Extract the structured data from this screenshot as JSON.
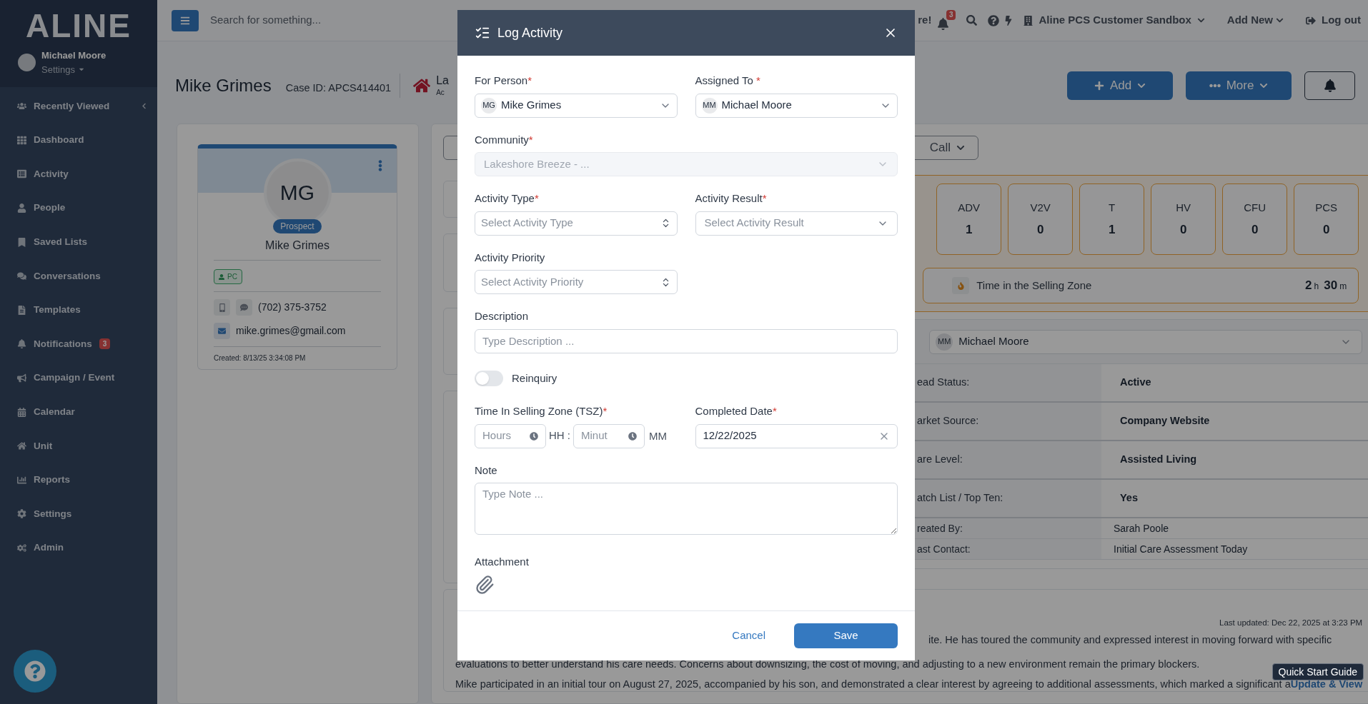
{
  "sidebar": {
    "logo": "ALINE",
    "user": {
      "name": "Michael Moore",
      "menu": "Settings"
    },
    "items": [
      {
        "label": "Recently Viewed"
      },
      {
        "label": "Dashboard"
      },
      {
        "label": "Activity"
      },
      {
        "label": "People"
      },
      {
        "label": "Saved Lists"
      },
      {
        "label": "Conversations"
      },
      {
        "label": "Templates"
      },
      {
        "label": "Notifications",
        "badge": "3"
      },
      {
        "label": "Campaign / Event"
      },
      {
        "label": "Calendar"
      },
      {
        "label": "Unit"
      },
      {
        "label": "Reports"
      },
      {
        "label": "Settings"
      },
      {
        "label": "Admin"
      }
    ]
  },
  "topbar": {
    "search_placeholder": "Search for something...",
    "cut_text": "re!",
    "notification_count": "3",
    "account": "Aline PCS Customer Sandbox",
    "add_new": "Add New",
    "logout": "Log out"
  },
  "header": {
    "name": "Mike Grimes",
    "case_id": "Case ID: APCS414401",
    "location_cut": "La",
    "location_sub_cut": "Ac",
    "add": "Add",
    "more": "More"
  },
  "profile": {
    "initials": "MG",
    "status": "Prospect",
    "name": "Mike Grimes",
    "tag": "PC",
    "phone": "(702) 375-3752",
    "email": "mike.grimes@gmail.com",
    "created": "Created: 8/13/25 3:34:08 PM"
  },
  "overview": {
    "dropdown": "Call",
    "stats": [
      {
        "label": "ADV",
        "value": "1"
      },
      {
        "label": "V2V",
        "value": "0"
      },
      {
        "label": "T",
        "value": "1"
      },
      {
        "label": "HV",
        "value": "0"
      },
      {
        "label": "CFU",
        "value": "0"
      },
      {
        "label": "PCS",
        "value": "0"
      }
    ],
    "selling_zone": {
      "label": "Time in the Selling Zone",
      "hours": "2",
      "hours_unit": "h",
      "minutes": "30",
      "minutes_unit": "m"
    }
  },
  "details": {
    "assignee": {
      "initials": "MM",
      "name": "Michael Moore"
    },
    "rows": [
      {
        "kind": "key",
        "label": "ead Status:",
        "value": "Active"
      },
      {
        "kind": "key",
        "label": "arket Source:",
        "value": "Company Website"
      },
      {
        "kind": "key",
        "label": "are Level:",
        "value": "Assisted Living"
      },
      {
        "kind": "key",
        "label": "atch List / Top Ten:",
        "value": "Yes"
      },
      {
        "kind": "meta",
        "label": "reated By:",
        "value": "Sarah Poole"
      },
      {
        "kind": "meta",
        "label": "ast Contact:",
        "value": "Initial Care Assessment Today"
      }
    ]
  },
  "notes": {
    "updated": "Last updated: Dec 22, 2025 at 3:23 PM",
    "line_1": "ite. He has toured the community and expressed interest in moving forward with specific",
    "line_2": "evaluations to better understand his care needs. Concerns about downsizing, the cost of moving, and adjusting to a new environment remain the primary blockers.",
    "line_3": "Mike participated in an initial tour on August 27, 2025, accompanied by his son, and demonstrated a clear interest by agreeing to additional assessments, which marked a significant a",
    "link": "Update & View"
  },
  "quick_start": "Quick Start Guide",
  "modal": {
    "title": "Log Activity",
    "rows": [
      [
        {
          "kind": "person",
          "label": "For Person",
          "required_mark": "*",
          "initials": "MG",
          "value": "Mike Grimes"
        },
        {
          "kind": "person",
          "label": "Assigned To",
          "required_mark": " *",
          "initials": "MM",
          "value": "Michael Moore"
        }
      ],
      [
        {
          "kind": "select",
          "label": "Community",
          "required_mark": "*",
          "value": "Lakeshore Breeze - ...",
          "disabled": true
        }
      ],
      [
        {
          "kind": "stepper",
          "label": "Activity Type",
          "required_mark": "*",
          "placeholder": "Select Activity Type"
        },
        {
          "kind": "select",
          "label": "Activity Result",
          "required_mark": "*",
          "placeholder": "Select Activity Result",
          "disabled": false
        }
      ],
      [
        {
          "kind": "stepper",
          "label": "Activity Priority",
          "placeholder": "Select Activity Priority"
        }
      ],
      [
        {
          "kind": "input",
          "label": "Description",
          "placeholder": "Type Description ..."
        }
      ],
      [
        {
          "kind": "toggle",
          "label": "Reinquiry",
          "on": false
        }
      ],
      [
        {
          "kind": "time",
          "label": "Time In Selling Zone (TSZ)",
          "required_mark": "*",
          "hours_placeholder": "Hours",
          "hours_unit": "HH :",
          "minutes_placeholder": "Minut",
          "minutes_unit": "MM"
        },
        {
          "kind": "date",
          "label": "Completed Date",
          "required_mark": "*",
          "value": "12/22/2025"
        }
      ],
      [
        {
          "kind": "textarea",
          "label": "Note",
          "placeholder": "Type Note ..."
        }
      ],
      [
        {
          "kind": "attachment",
          "label": "Attachment"
        }
      ]
    ],
    "cancel": "Cancel",
    "save": "Save"
  }
}
